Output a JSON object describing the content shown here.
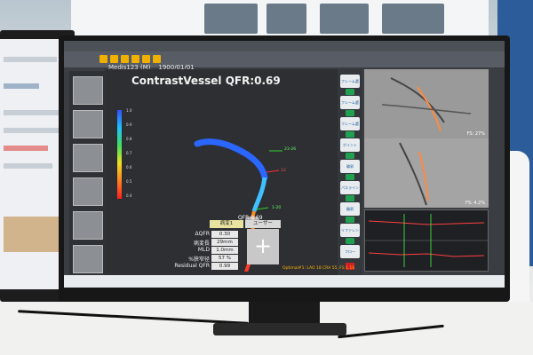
{
  "viewer": {
    "title": "ContrastVessel QFR:0.69",
    "patient_name": "Medis123 (M)",
    "patient_date": "1900/01/01",
    "colorbar_ticks": [
      "1.0",
      "0.9",
      "0.8",
      "0.7",
      "0.6",
      "0.5",
      "0.4"
    ],
    "segment_labels": [
      "23-26",
      "13",
      "1-20"
    ],
    "qfr_end_label": "QFR:0.69"
  },
  "results_table": {
    "column_headers": [
      "病変1",
      "ユーザー"
    ],
    "rows": [
      {
        "label": "ΔQFR",
        "value": "0.30"
      },
      {
        "label": "病変長",
        "value": "29mm"
      },
      {
        "label": "MLD",
        "value": "1.0mm"
      },
      {
        "label": "%狭窄径",
        "value": "57 %"
      },
      {
        "label": "Residual QFR",
        "value": "0.99"
      }
    ],
    "user_add_symbol": "+"
  },
  "side_buttons": [
    "フレーム選択",
    "フレーム選択",
    "フレーム選択",
    "ポイント",
    "輪郭",
    "パスライン",
    "輪郭",
    "リファレンス",
    "フロー"
  ],
  "angio_views": [
    {
      "label": "FS: 27%"
    },
    {
      "label": "FS: 4.2%"
    }
  ],
  "status_text": "Optimal#1: LAO 18 CRA 55, FS 1.16",
  "colors": {
    "vessel_blue": "#2a66ff",
    "vessel_red": "#ff3a2a",
    "accent_yellow": "#f0b000",
    "check_green": "#20a050"
  }
}
